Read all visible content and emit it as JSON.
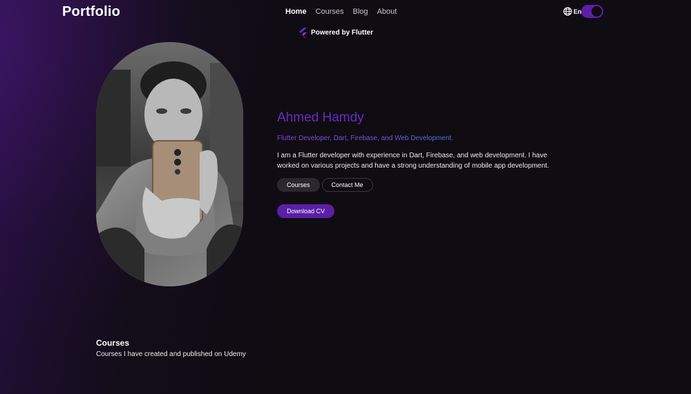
{
  "header": {
    "logo": "Portfolio",
    "nav": [
      {
        "label": "Home",
        "active": true
      },
      {
        "label": "Courses",
        "active": false
      },
      {
        "label": "Blog",
        "active": false
      },
      {
        "label": "About",
        "active": false
      }
    ],
    "language_icon": "globe-icon",
    "language_code": "En",
    "theme_toggle": {
      "state": "on",
      "accent": "#5b1fa6"
    }
  },
  "powered_by": {
    "icon": "flutter-logo-icon",
    "text": "Powered by Flutter"
  },
  "hero": {
    "name": "Ahmed Hamdy",
    "subtitle": "Flutter Developer, Dart, Firebase, and Web Development.",
    "bio": "I am a Flutter developer with experience in Dart, Firebase, and web development. I have worked on various projects and have a strong understanding of mobile app development.",
    "buttons": {
      "courses": "Courses",
      "contact": "Contact Me",
      "download_cv": "Download CV"
    },
    "photo": "profile-photo"
  },
  "courses_section": {
    "title": "Courses",
    "subtitle": "Courses I have created and published on Udemy"
  },
  "colors": {
    "background": "#0f0c12",
    "accent": "#5b1fa6",
    "name": "#6a2bc0",
    "subtitle_gradient": [
      "#8a3fe0",
      "#5a6fd8"
    ]
  }
}
